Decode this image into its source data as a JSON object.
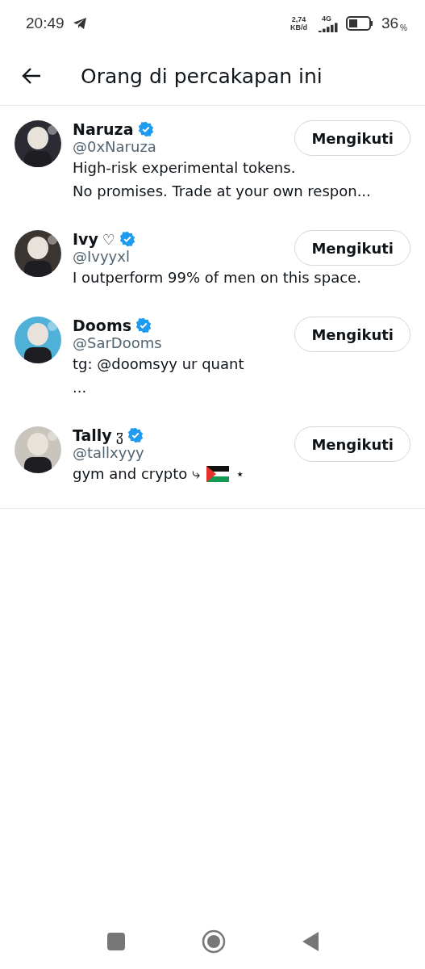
{
  "status_bar": {
    "time": "20:49",
    "speed_value": "2,74",
    "speed_unit": "KB/d",
    "network": "4G",
    "battery": "36",
    "battery_unit": "%"
  },
  "header": {
    "title": "Orang di percakapan ini"
  },
  "people": [
    {
      "name": "Naruza",
      "verified": true,
      "handle": "@0xNaruza",
      "bio": [
        "High-risk experimental tokens.",
        "No promises. Trade at your own respon..."
      ],
      "button": "Mengikuti"
    },
    {
      "name": "Ivy",
      "name_symbol": "♡",
      "verified": true,
      "handle": "@Ivyyxl",
      "bio": [
        "I outperform 99% of men on this space."
      ],
      "button": "Mengikuti"
    },
    {
      "name": "Dooms",
      "verified": true,
      "handle": "@SarDooms",
      "bio": [
        "tg: @doomsyy ur quant",
        "..."
      ],
      "button": "Mengikuti"
    },
    {
      "name": "Tally",
      "name_symbol": "ჳ",
      "verified": true,
      "handle": "@tallxyyy",
      "bio": [
        "gym and crypto ⤷"
      ],
      "bio_tail": [
        {
          "kind": "flag"
        },
        {
          "kind": "text",
          "text": "⋆"
        }
      ],
      "button": "Mengikuti"
    }
  ]
}
